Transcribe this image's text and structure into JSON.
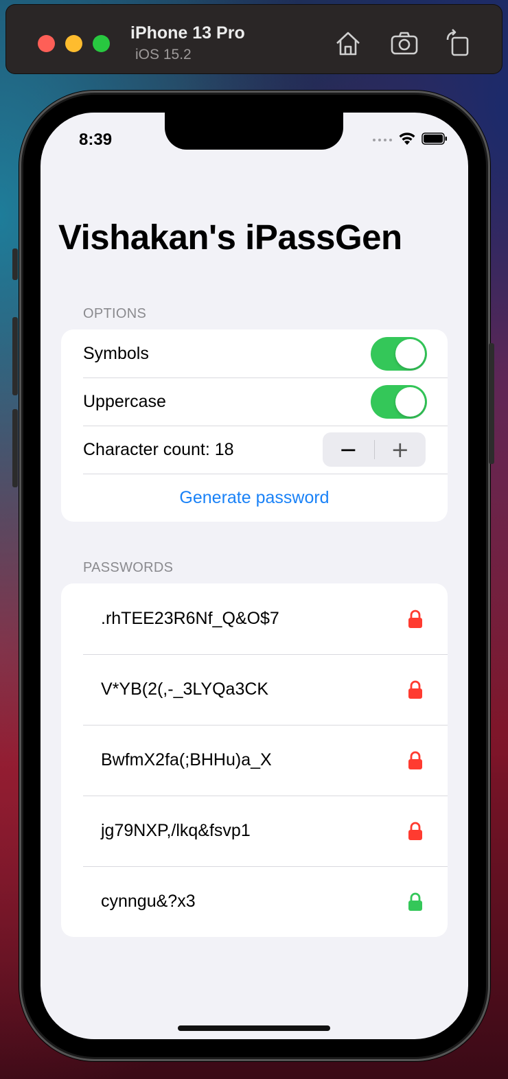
{
  "simulator": {
    "device_name": "iPhone 13 Pro",
    "os_version": "iOS 15.2",
    "buttons": [
      "home-icon",
      "screenshot-icon",
      "rotate-icon"
    ]
  },
  "status_bar": {
    "time": "8:39"
  },
  "app": {
    "title": "Vishakan's iPassGen"
  },
  "options": {
    "header": "OPTIONS",
    "symbols_label": "Symbols",
    "symbols_on": true,
    "uppercase_label": "Uppercase",
    "uppercase_on": true,
    "count_label": "Character count: 18",
    "stepper_minus": "−",
    "stepper_plus": "+",
    "generate_label": "Generate password"
  },
  "passwords": {
    "header": "PASSWORDS",
    "items": [
      {
        "text": ".rhTEE23R6Nf_Q&O$7",
        "lock_color": "#ff3b30"
      },
      {
        "text": "V*YB(2(,-_3LYQa3CK",
        "lock_color": "#ff3b30"
      },
      {
        "text": "BwfmX2fa(;BHHu)a_X",
        "lock_color": "#ff3b30"
      },
      {
        "text": "jg79NXP,/lkq&fsvp1",
        "lock_color": "#ff3b30"
      },
      {
        "text": "cynngu&?x3",
        "lock_color": "#34c759"
      }
    ]
  },
  "colors": {
    "accent": "#1a82f7",
    "toggle_on": "#34c759",
    "lock_red": "#ff3b30",
    "lock_green": "#34c759",
    "background": "#f2f2f7"
  }
}
